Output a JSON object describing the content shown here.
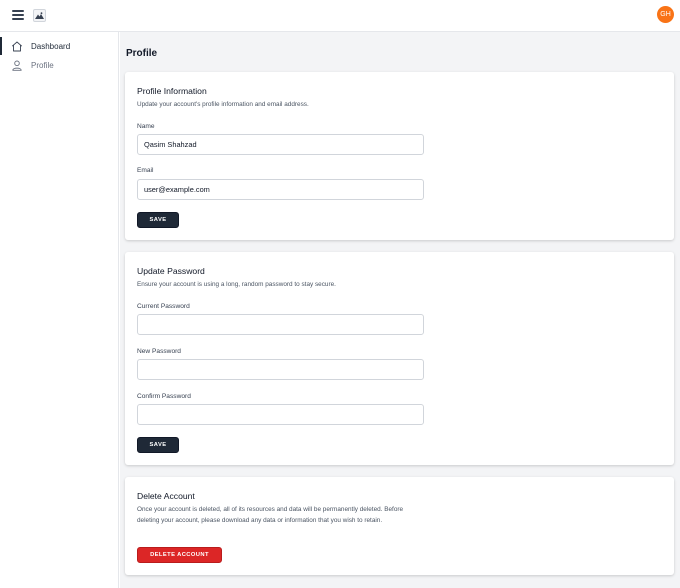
{
  "header": {
    "menu_icon": "hamburger-icon",
    "logo_icon": "app-logo-icon",
    "avatar_initials": "GH",
    "avatar_color": "#f97316"
  },
  "sidebar": {
    "items": [
      {
        "label": "Dashboard",
        "icon": "home-icon",
        "active": true
      },
      {
        "label": "Profile",
        "icon": "user-icon",
        "active": false
      }
    ]
  },
  "main": {
    "page_title": "Profile",
    "profile_info": {
      "title": "Profile Information",
      "description": "Update your account's profile information and email address.",
      "name_label": "Name",
      "name_value": "Qasim Shahzad",
      "email_label": "Email",
      "email_value": "user@example.com",
      "save_label": "SAVE"
    },
    "update_password": {
      "title": "Update Password",
      "description": "Ensure your account is using a long, random password to stay secure.",
      "current_label": "Current Password",
      "new_label": "New Password",
      "confirm_label": "Confirm Password",
      "save_label": "SAVE"
    },
    "delete_account": {
      "title": "Delete Account",
      "description": "Once your account is deleted, all of its resources and data will be permanently deleted. Before deleting your account, please download any data or information that you wish to retain.",
      "button_label": "DELETE ACCOUNT",
      "button_color": "#dc2626"
    }
  }
}
